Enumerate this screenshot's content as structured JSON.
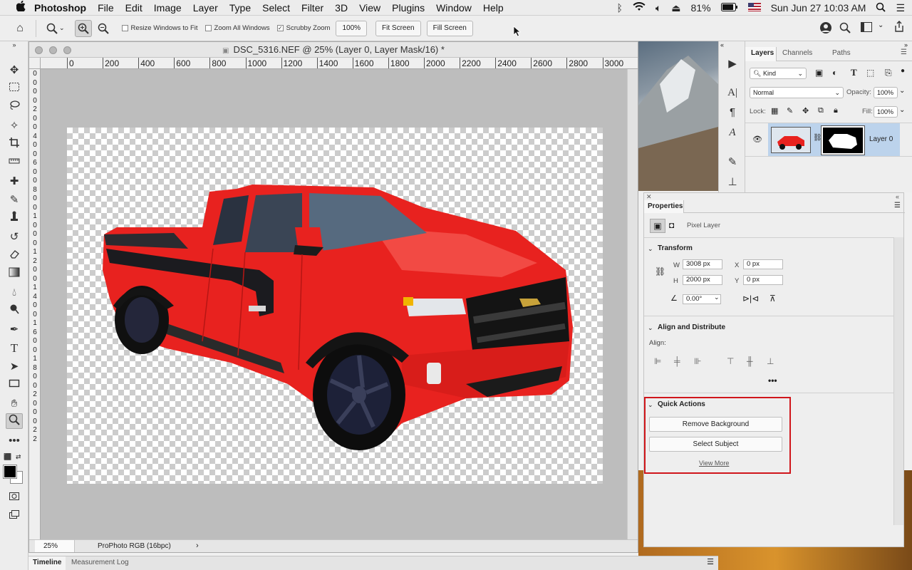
{
  "menubar": {
    "apple": "",
    "app": "Photoshop",
    "items": [
      "File",
      "Edit",
      "Image",
      "Layer",
      "Type",
      "Select",
      "Filter",
      "3D",
      "View",
      "Plugins",
      "Window",
      "Help"
    ],
    "battery": "81%",
    "datetime": "Sun Jun 27  10:03 AM"
  },
  "options": {
    "resize_windows": "Resize Windows to Fit",
    "zoom_all": "Zoom All Windows",
    "scrubby": "Scrubby Zoom",
    "zoom_value": "100%",
    "fit_screen": "Fit Screen",
    "fill_screen": "Fill Screen"
  },
  "document": {
    "title": "DSC_5316.NEF @ 25% (Layer 0, Layer Mask/16) *",
    "ruler_h": [
      "0",
      "200",
      "400",
      "600",
      "800",
      "1000",
      "1200",
      "1400",
      "1600",
      "1800",
      "2000",
      "2200",
      "2400",
      "2600",
      "2800",
      "3000"
    ],
    "ruler_v": [
      "0",
      "0",
      "0",
      "0",
      "2",
      "0",
      "0",
      "4",
      "0",
      "0",
      "6",
      "0",
      "0",
      "8",
      "0",
      "0",
      "1",
      "0",
      "0",
      "0",
      "1",
      "2",
      "0",
      "0",
      "1",
      "4",
      "0",
      "0",
      "1",
      "6",
      "0",
      "0",
      "1",
      "8",
      "0",
      "0",
      "2",
      "0",
      "0",
      "0",
      "2",
      "2"
    ],
    "zoom": "25%",
    "color_profile": "ProPhoto RGB (16bpc)"
  },
  "bottom_tabs": [
    "Timeline",
    "Measurement Log"
  ],
  "layers_panel": {
    "tabs": [
      "Layers",
      "Channels",
      "Paths"
    ],
    "filter_kind": "Kind",
    "blend_mode": "Normal",
    "opacity_label": "Opacity:",
    "opacity": "100%",
    "lock_label": "Lock:",
    "fill_label": "Fill:",
    "fill": "100%",
    "layer_name": "Layer 0"
  },
  "properties": {
    "title": "Properties",
    "kind": "Pixel Layer",
    "transform": {
      "heading": "Transform",
      "w_label": "W",
      "w": "3008 px",
      "h_label": "H",
      "h": "2000 px",
      "x_label": "X",
      "x": "0 px",
      "y_label": "Y",
      "y": "0 px",
      "angle": "0.00°"
    },
    "align": {
      "heading": "Align and Distribute",
      "label": "Align:"
    },
    "quick_actions": {
      "heading": "Quick Actions",
      "remove_bg": "Remove Background",
      "select_subject": "Select Subject",
      "view_more": "View More"
    }
  },
  "colors": {
    "highlight_red": "#d0161b",
    "truck_red": "#e8221f",
    "layer_highlight": "#bcd3ec"
  }
}
